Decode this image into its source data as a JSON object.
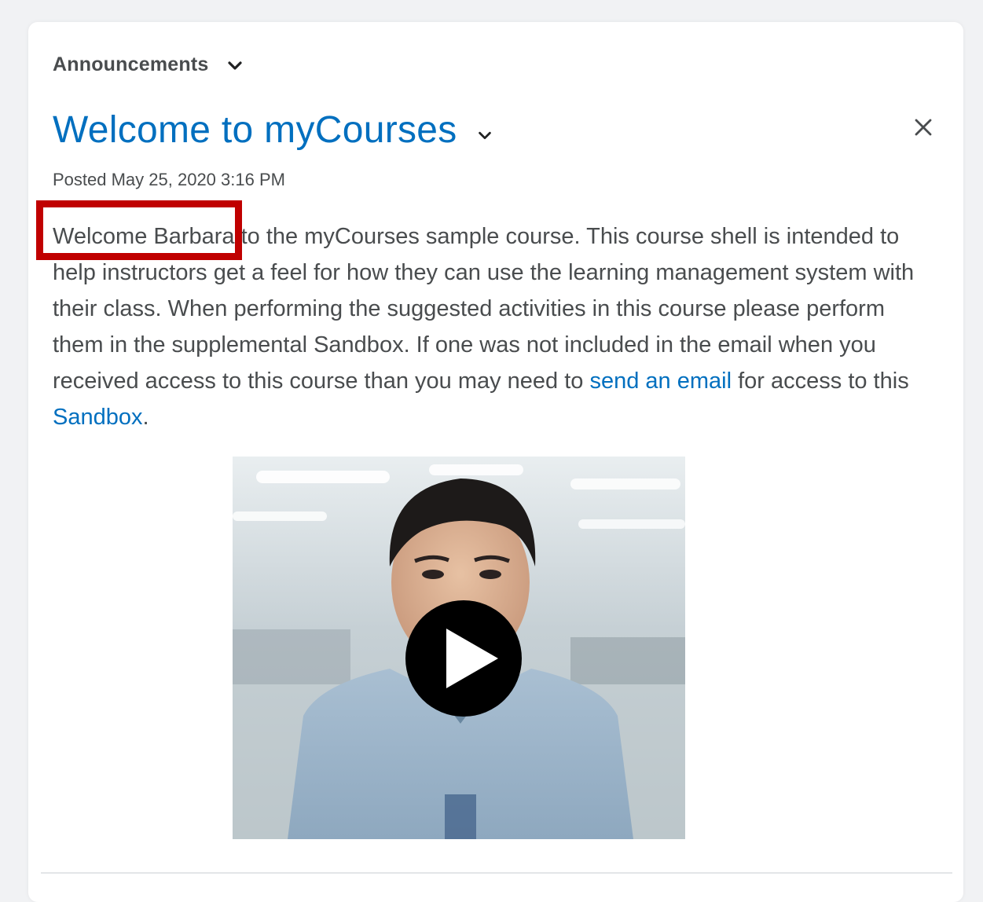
{
  "widget": {
    "title": "Announcements"
  },
  "announcement": {
    "title": "Welcome to myCourses",
    "posted": "Posted May 25, 2020 3:16 PM",
    "body": {
      "highlighted": "Welcome Barbara",
      "part1": " to the myCourses sample course. This course shell is intended to help instructors get a feel for how they can use the learning management system with their class. When performing the suggested activities in this course please perform them in the supplemental Sandbox. If one was not included in the email when you received access to this course than you may need to ",
      "link1": "send an email",
      "part2": " for access to this ",
      "link2": "Sandbox",
      "part3": "."
    }
  },
  "icons": {
    "widget_menu": "chevron-down-icon",
    "title_menu": "chevron-down-icon",
    "close": "close-icon",
    "play": "play-icon"
  },
  "colors": {
    "link": "#006fbf",
    "text": "#494c4e",
    "highlight": "#c00000"
  }
}
